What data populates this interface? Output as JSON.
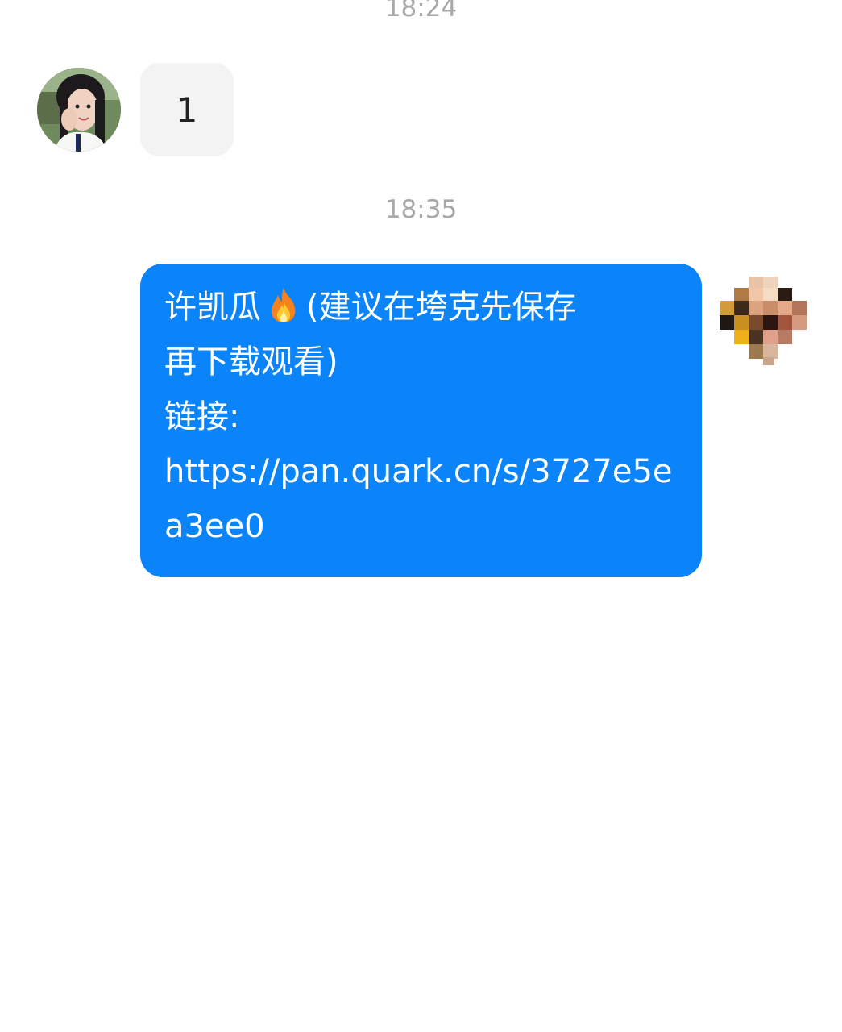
{
  "timestamps": [
    "18:24",
    "18:35"
  ],
  "incoming_message": {
    "text": "1",
    "avatar_icon": "user-avatar-photo"
  },
  "outgoing_message": {
    "avatar_icon": "pixelated-avatar",
    "lines": [
      {
        "before_emoji": "许凯瓜",
        "emoji": "fire-emoji",
        "after_emoji": "(建议在垮克先保存"
      },
      {
        "text": "再下载观看)"
      },
      {
        "text": "链接:"
      },
      {
        "text": "https://pan.quark.cn/s/3727e5e"
      },
      {
        "text": "a3ee0"
      }
    ]
  },
  "colors": {
    "outgoing_bubble": "#0a84f8",
    "incoming_bubble": "#f3f3f3",
    "timestamp_text": "#a8a8a8"
  }
}
